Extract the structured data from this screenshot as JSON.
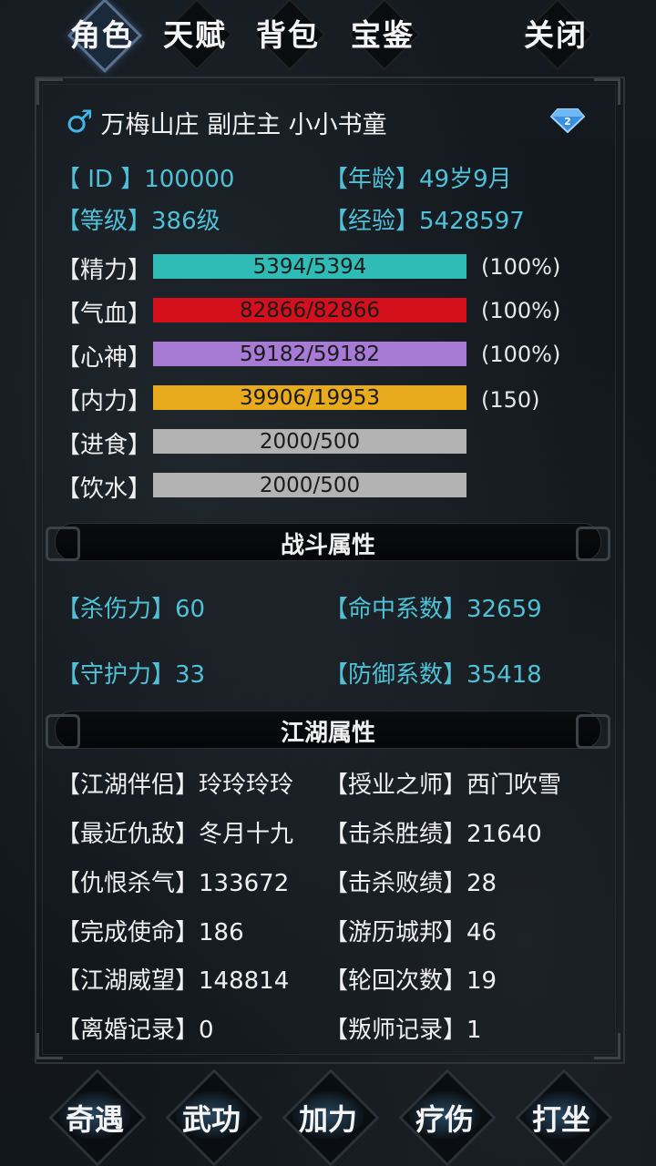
{
  "tabs": [
    {
      "label": "角色",
      "active": true
    },
    {
      "label": "天赋",
      "active": false
    },
    {
      "label": "背包",
      "active": false
    },
    {
      "label": "宝鉴",
      "active": false
    }
  ],
  "close_label": "关闭",
  "header": {
    "gender_icon": "male-symbol-icon",
    "gender_symbol": "♂",
    "title": "万梅山庄 副庄主 小小书童",
    "rank_icon": "diamond-rank-icon",
    "rank_number": "2"
  },
  "info": {
    "id_label": "【 ID 】",
    "id_value": "100000",
    "age_label": "【年龄】",
    "age_value": "49岁9月",
    "level_label": "【等级】",
    "level_value": "386级",
    "exp_label": "【经验】",
    "exp_value": "5428597"
  },
  "stats": [
    {
      "label": "【精力】",
      "text": "5394/5394",
      "pct": "(100%)",
      "color": "#2fbcb6",
      "fill": 1.0
    },
    {
      "label": "【气血】",
      "text": "82866/82866",
      "pct": "(100%)",
      "color": "#d3101c",
      "fill": 1.0
    },
    {
      "label": "【心神】",
      "text": "59182/59182",
      "pct": "(100%)",
      "color": "#a77ad6",
      "fill": 1.0
    },
    {
      "label": "【内力】",
      "text": "39906/19953",
      "pct": "(150)",
      "color": "#e8ab1e",
      "fill": 1.0
    },
    {
      "label": "【进食】",
      "text": "2000/500",
      "pct": "",
      "color": "#b3b3b3",
      "fill": 1.0
    },
    {
      "label": "【饮水】",
      "text": "2000/500",
      "pct": "",
      "color": "#b3b3b3",
      "fill": 1.0
    }
  ],
  "combat_title": "战斗属性",
  "combat": {
    "attack_label": "【杀伤力】",
    "attack_value": "60",
    "hit_label": "【命中系数】",
    "hit_value": "32659",
    "defense_label": "【守护力】",
    "defense_value": "33",
    "def_coef_label": "【防御系数】",
    "def_coef_value": "35418"
  },
  "jianghu_title": "江湖属性",
  "jianghu": {
    "left": [
      {
        "label": "【江湖伴侣】",
        "value": "玲玲玲玲"
      },
      {
        "label": "【最近仇敌】",
        "value": "冬月十九"
      },
      {
        "label": "【仇恨杀气】",
        "value": "133672"
      },
      {
        "label": "【完成使命】",
        "value": "186"
      },
      {
        "label": "【江湖威望】",
        "value": "148814"
      },
      {
        "label": "【离婚记录】",
        "value": "0"
      }
    ],
    "right": [
      {
        "label": "【授业之师】",
        "value": "西门吹雪"
      },
      {
        "label": "【击杀胜绩】",
        "value": "21640"
      },
      {
        "label": "【击杀败绩】",
        "value": "28"
      },
      {
        "label": "【游历城邦】",
        "value": "46"
      },
      {
        "label": "【轮回次数】",
        "value": "19"
      },
      {
        "label": "【叛师记录】",
        "value": "1"
      }
    ]
  },
  "bottom": [
    "奇遇",
    "武功",
    "加力",
    "疗伤",
    "打坐"
  ],
  "colors": {
    "accent": "#4fc0d6",
    "gender": "#3fb7e6"
  }
}
